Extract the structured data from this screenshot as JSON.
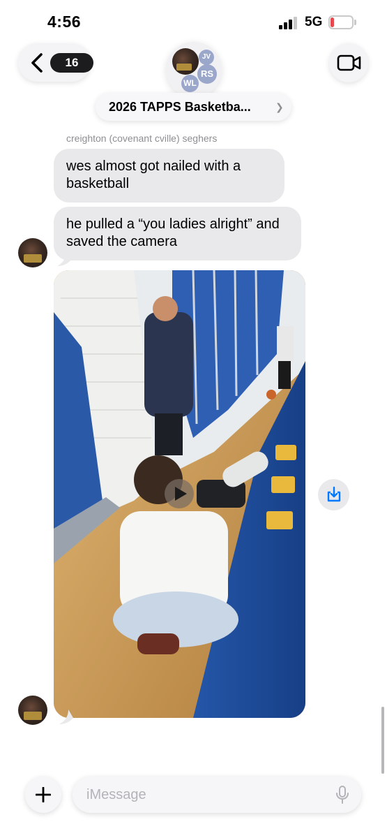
{
  "status_bar": {
    "time": "4:56",
    "network": "5G",
    "battery_level": "18",
    "battery_fraction": 0.18
  },
  "header": {
    "back_count": "16",
    "group_name": "2026 TAPPS Basketba...",
    "group_chevron": "❯",
    "member_initials": [
      "JV",
      "RS",
      "WL"
    ]
  },
  "messages": [
    {
      "sender": "creighton (covenant cville) seghers",
      "text": "wes almost got nailed with a basketball"
    },
    {
      "text": "he pulled a “you ladies alright” and saved the camera"
    }
  ],
  "input": {
    "placeholder": "iMessage"
  },
  "icons": {
    "back": "chevron-left-icon",
    "video": "video-camera-icon",
    "play": "play-icon",
    "save": "save-download-icon",
    "plus": "plus-icon",
    "mic": "microphone-icon"
  },
  "colors": {
    "bubble_gray": "#e9e9eb",
    "accent_blue": "#007aff",
    "battery_red": "#e5484d",
    "avatar_initials_bg": "#9aa7cb"
  }
}
